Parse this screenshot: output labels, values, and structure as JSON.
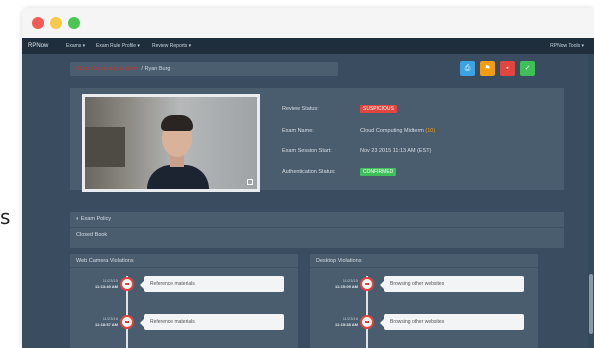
{
  "side_letter": "s",
  "navbar": {
    "brand": "RPNow",
    "menu": [
      "Exams ▾",
      "Exam Rule Profile ▾",
      "Review Reports ▾"
    ],
    "right": "RPNow Tools ▾"
  },
  "breadcrumb": {
    "parent": "Cloud Computing Midterm",
    "separator": "/",
    "current": "Ryan Burg"
  },
  "actions": [
    {
      "icon": "print-icon",
      "color": "#3aa3e3"
    },
    {
      "icon": "flag-icon",
      "color": "#f39c12"
    },
    {
      "icon": "trash-icon",
      "color": "#e0453f"
    },
    {
      "icon": "check-icon",
      "color": "#3fbf5a"
    }
  ],
  "review": {
    "status_label": "Review Status:",
    "status_value": "SUSPICIOUS",
    "exam_label": "Exam Name:",
    "exam_value": "Cloud Computing Midterm",
    "exam_tag": "(10)",
    "session_label": "Exam Session Start:",
    "session_value": "Nov 23 2015 11:13 AM (EST)",
    "auth_label": "Authentication Status:",
    "auth_value": "CONFIRMED"
  },
  "policy": {
    "title": "Exam Policy",
    "body": "Closed Book"
  },
  "webcam": {
    "title": "Web Camera Violations",
    "entries": [
      {
        "date": "11/23/15",
        "time": "11:13:40 AM",
        "text": "Reference materials"
      },
      {
        "date": "11/23/15",
        "time": "11:18:57 AM",
        "text": "Reference materials"
      }
    ]
  },
  "desktop": {
    "title": "Desktop Violations",
    "entries": [
      {
        "date": "11/23/15",
        "time": "11:15:09 AM",
        "text": "Browsing other websites"
      },
      {
        "date": "11/23/15",
        "time": "11:15:38 AM",
        "text": "Browsing other websites"
      }
    ]
  }
}
